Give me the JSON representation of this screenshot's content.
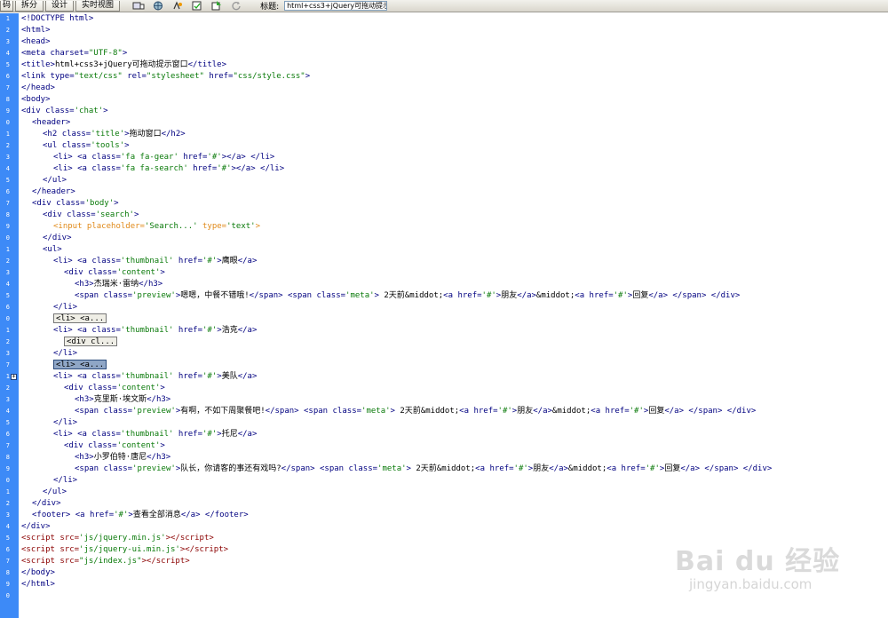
{
  "toolbar": {
    "code_button": "码",
    "split_button": "拆分",
    "design_button": "设计",
    "live_view_button": "实时视图",
    "title_label": "标题:",
    "title_value": "html+css3+jQuery可拖动提示窗口"
  },
  "collapsed": {
    "block1": "<li> <a...",
    "block2": "<div cl...",
    "block3": "<li> <a..."
  },
  "watermark": {
    "logo": "Bai du 经验",
    "url": "jingyan.baidu.com"
  },
  "code_text": {
    "title": "html+css3+jQuery可拖动提示窗口",
    "h2": "拖动窗口",
    "name1": "鹰眼",
    "h3_1": "杰瑞米·雷纳",
    "preview1": "嗯嗯，中餐不错哦!",
    "name2": "浩克",
    "name3": "美队",
    "h3_3": "克里斯·埃文斯",
    "preview3": "有啊，不如下周聚餐吧!",
    "name4": "托尼",
    "h3_4": "小罗伯特·唐尼",
    "preview4": "队长，你请客的事还有戏吗?",
    "meta_time": "2天前",
    "friend": "朋友",
    "reply": "回复",
    "footer_link": "查看全部消息"
  }
}
